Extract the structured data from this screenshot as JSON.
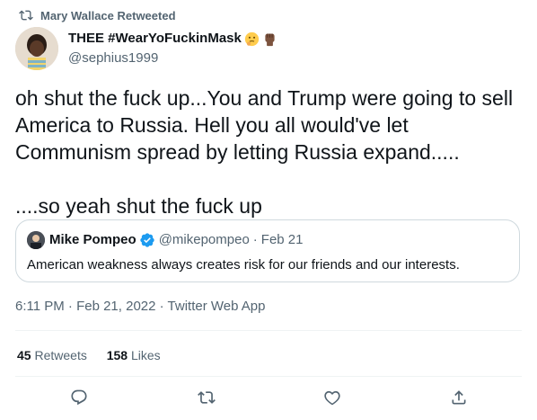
{
  "retweet_context": {
    "text": "Mary Wallace Retweeted",
    "icon": "retweet-icon"
  },
  "author": {
    "display_name": "THEE #WearYoFuckinMask",
    "emojis": [
      "thinking-face-emoji",
      "raised-fist-emoji"
    ],
    "handle": "@sephius1999"
  },
  "tweet": {
    "text": "oh shut the fuck up...You and Trump were going to sell America to Russia. Hell you all would've let Communism spread by letting Russia expand.....\n\n....so yeah shut the fuck up"
  },
  "quoted_tweet": {
    "display_name": "Mike Pompeo",
    "verified": true,
    "handle": "@mikepompeo",
    "separator": "·",
    "date": "Feb 21",
    "text": "American weakness always creates risk for our friends and our interests."
  },
  "meta": {
    "timestamp": "6:11 PM · Feb 21, 2022 · Twitter Web App"
  },
  "stats": {
    "retweets_count": "45",
    "retweets_label": "Retweets",
    "likes_count": "158",
    "likes_label": "Likes"
  },
  "actions": [
    "reply-icon",
    "retweet-icon",
    "like-icon",
    "share-icon"
  ],
  "colors": {
    "text": "#0f1419",
    "secondary": "#536471",
    "border": "#cfd9de",
    "verified": "#1d9bf0"
  }
}
